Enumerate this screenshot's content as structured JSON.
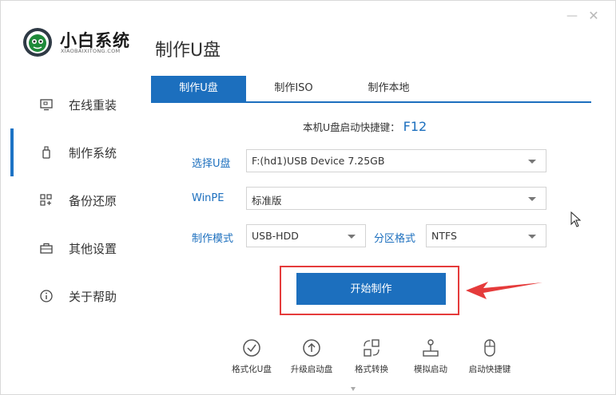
{
  "window": {
    "minimize_glyph": "—",
    "close_glyph": "✕"
  },
  "logo": {
    "name": "小白系统",
    "url": "XIAOBAIXITONG.COM"
  },
  "page_title": "制作U盘",
  "sidebar": {
    "items": [
      {
        "label": "在线重装",
        "icon": "monitor-icon"
      },
      {
        "label": "制作系统",
        "icon": "usb-icon",
        "active": true
      },
      {
        "label": "备份还原",
        "icon": "grid-icon"
      },
      {
        "label": "其他设置",
        "icon": "briefcase-icon"
      },
      {
        "label": "关于帮助",
        "icon": "info-icon"
      }
    ]
  },
  "tabs": [
    {
      "label": "制作U盘",
      "active": true
    },
    {
      "label": "制作ISO"
    },
    {
      "label": "制作本地"
    }
  ],
  "hint": {
    "text": "本机U盘启动快捷键：",
    "key": "F12"
  },
  "form": {
    "usb_label": "选择U盘",
    "usb_value": "F:(hd1)USB Device 7.25GB",
    "winpe_label": "WinPE",
    "winpe_value": "标准版",
    "mode_label": "制作模式",
    "mode_value": "USB-HDD",
    "partition_label": "分区格式",
    "partition_value": "NTFS"
  },
  "start_button": "开始制作",
  "tools": [
    {
      "label": "格式化U盘",
      "icon": "check-circle-icon"
    },
    {
      "label": "升级启动盘",
      "icon": "arrow-up-circle-icon"
    },
    {
      "label": "格式转换",
      "icon": "convert-icon"
    },
    {
      "label": "模拟启动",
      "icon": "joystick-icon"
    },
    {
      "label": "启动快捷键",
      "icon": "mouse-icon"
    }
  ],
  "colors": {
    "accent": "#1c6fbe",
    "highlight": "#e53b3b"
  }
}
